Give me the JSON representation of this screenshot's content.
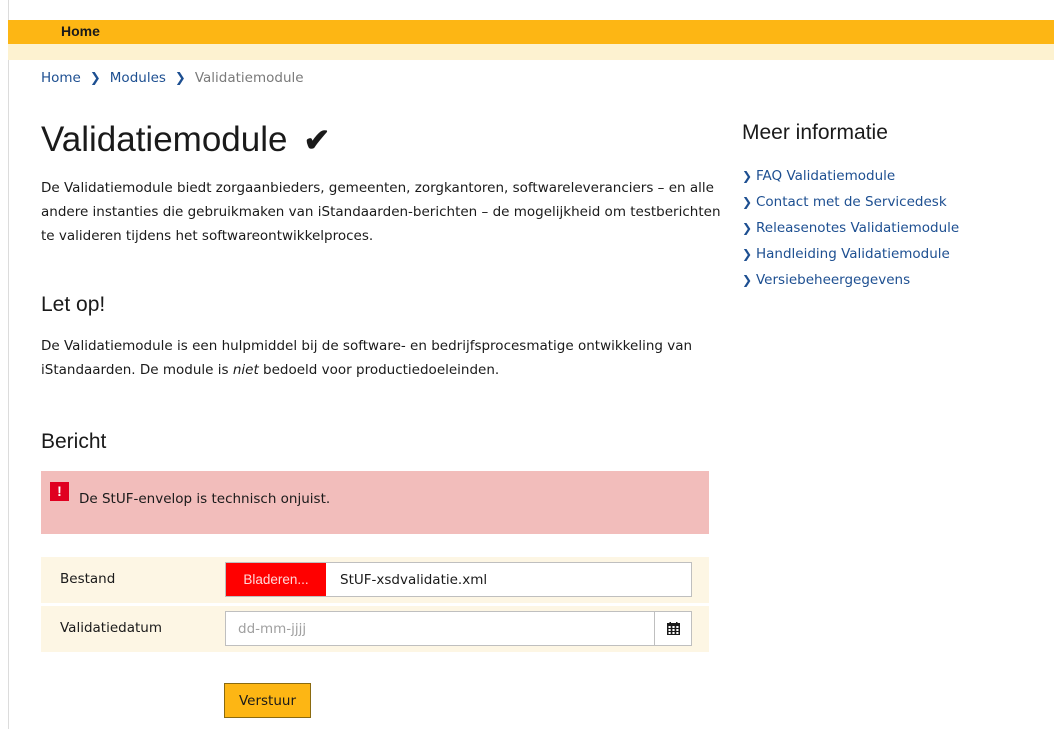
{
  "nav": {
    "home_label": "Home"
  },
  "breadcrumb": {
    "items": [
      "Home",
      "Modules"
    ],
    "current": "Validatiemodule"
  },
  "page": {
    "title": "Validatiemodule",
    "intro": "De Validatiemodule biedt zorgaanbieders, gemeenten, zorgkantoren, softwareleveranciers – en alle andere instanties die gebruikmaken van iStandaarden-berichten – de mogelijkheid om testberichten te valideren tijdens het softwareontwikkelproces.",
    "letop_heading": "Let op!",
    "letop_text_before": "De Validatiemodule is een hulpmiddel bij de software- en bedrijfsprocesmatige ontwikkeling van iStandaarden. De module is ",
    "letop_text_em": "niet",
    "letop_text_after": " bedoeld voor productiedoeleinden.",
    "bericht_heading": "Bericht"
  },
  "alert": {
    "icon": "!",
    "text": "De StUF-envelop is technisch onjuist.",
    "color": "#f2bdbb"
  },
  "form": {
    "file_label": "Bestand",
    "browse_label": "Bladeren...",
    "file_name": "StUF-xsdvalidatie.xml",
    "date_label": "Validatiedatum",
    "date_placeholder": "dd-mm-jjjj",
    "submit_label": "Verstuur"
  },
  "sidebar": {
    "title": "Meer informatie",
    "links": [
      {
        "label": "FAQ Validatiemodule"
      },
      {
        "label": "Contact met de Servicedesk"
      },
      {
        "label": "Releasenotes Validatiemodule"
      },
      {
        "label": "Handleiding Validatiemodule"
      },
      {
        "label": "Versiebeheergegevens"
      }
    ]
  },
  "colors": {
    "accent": "#fdb614",
    "link": "#1d4f91",
    "error": "#e00020",
    "browse_button": "#ff0000"
  },
  "icons": {
    "title_check": "checkmark-icon",
    "breadcrumb_separator": "chevron-right-icon",
    "calendar": "calendar-icon",
    "alert": "exclamation-icon"
  }
}
